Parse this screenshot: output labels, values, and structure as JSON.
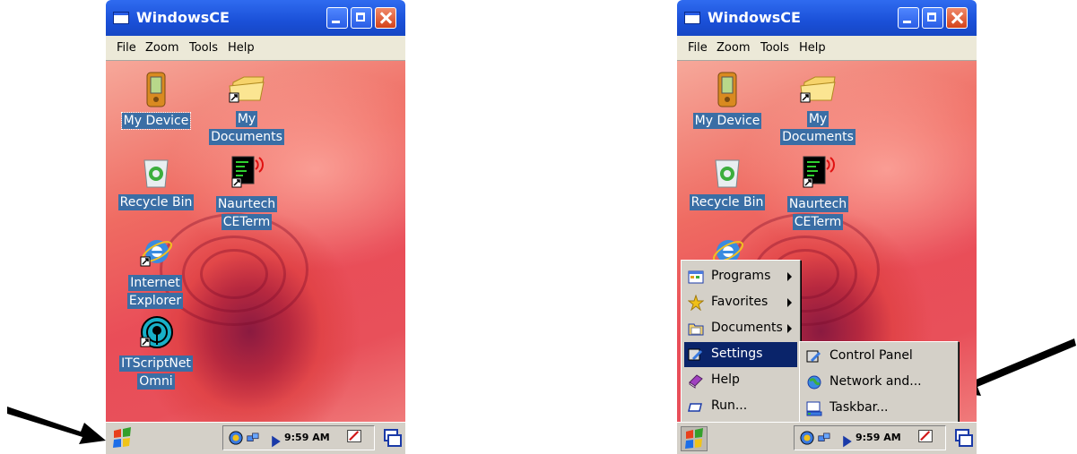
{
  "window": {
    "title": "WindowsCE"
  },
  "menubar": {
    "file": "File",
    "zoom": "Zoom",
    "tools": "Tools",
    "help": "Help"
  },
  "desktop_icons": {
    "my_device": "My Device",
    "my_documents_1": "My",
    "my_documents_2": "Documents",
    "recycle_bin": "Recycle Bin",
    "naurtech_1": "Naurtech",
    "naurtech_2": "CETerm",
    "ie_1": "Internet",
    "ie_2": "Explorer",
    "itscript_1": "ITScriptNet",
    "itscript_2": "Omni"
  },
  "taskbar": {
    "clock": "9:59 AM"
  },
  "start_menu": {
    "programs": "Programs",
    "favorites": "Favorites",
    "documents": "Documents",
    "settings": "Settings",
    "help": "Help",
    "run": "Run..."
  },
  "settings_submenu": {
    "control_panel": "Control Panel",
    "network": "Network and...",
    "taskbar": "Taskbar..."
  },
  "colors": {
    "titlebar": "#1a50d8",
    "selection": "#0a246a",
    "label_bg": "#3a6ea5"
  }
}
